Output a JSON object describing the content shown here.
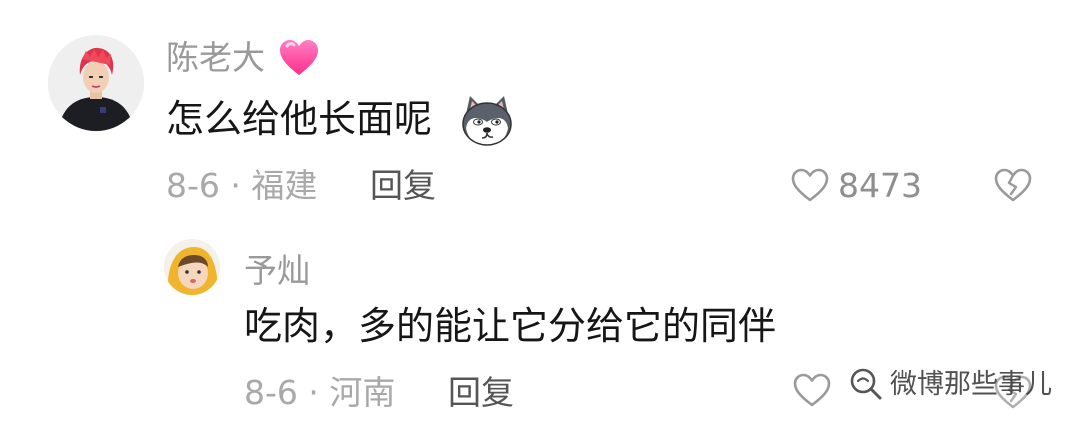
{
  "comments": [
    {
      "username": "陈老大",
      "name_badge_icon": "pink-heart-icon",
      "text": "怎么给他长面呢",
      "emoji_icon": "husky-dog-emoji-icon",
      "date_location": "8-6 · 福建",
      "reply_label": "回复",
      "like_count": "8473"
    },
    {
      "username": "予灿",
      "text": "吃肉，多的能让它分给它的同伴",
      "date_location": "8-6 · 河南",
      "reply_label": "回复"
    }
  ],
  "watermark": {
    "icon": "wechat-search-icon",
    "text": "微博那些事儿"
  },
  "colors": {
    "username": "#9a9a9a",
    "text": "#161616",
    "meta": "#a9a9a9",
    "badge_pink": "#ff3d9a"
  }
}
